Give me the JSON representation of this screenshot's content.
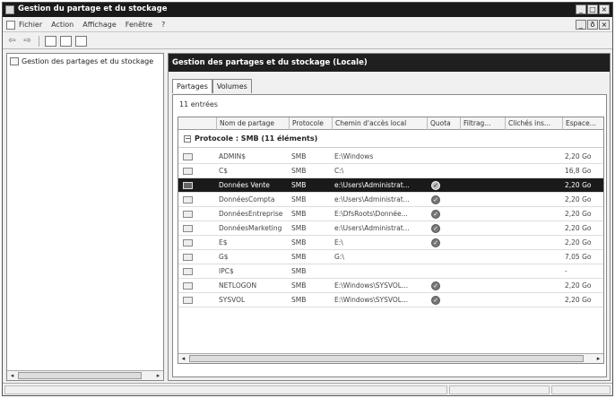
{
  "window": {
    "title": "Gestion du partage et du stockage"
  },
  "menu": [
    "Fichier",
    "Action",
    "Affichage",
    "Fenêtre",
    "?"
  ],
  "window_buttons": [
    "_",
    "□",
    "×"
  ],
  "mdi_buttons": [
    "_",
    "ð",
    "×"
  ],
  "tree": {
    "item": "Gestion des partages et du stockage"
  },
  "panel": {
    "header": "Gestion des partages et du stockage (Locale)",
    "tabs": [
      "Partages",
      "Volumes"
    ],
    "count": "11 entrées"
  },
  "grid": {
    "columns": [
      "Nom de partage",
      "Protocole",
      "Chemin d'accès local",
      "Quota",
      "Filtrag...",
      "Clichés ins...",
      "Espace..."
    ],
    "group": "Protocole : SMB (11 éléments)",
    "group_toggle": "−",
    "rows": [
      {
        "name": "ADMIN$",
        "protocol": "SMB",
        "path": "E:\\Windows",
        "quota": false,
        "space": "2,20 Go"
      },
      {
        "name": "C$",
        "protocol": "SMB",
        "path": "C:\\",
        "quota": false,
        "space": "16,8 Go"
      },
      {
        "name": "Données Vente",
        "protocol": "SMB",
        "path": "e:\\Users\\Administrat...",
        "quota": true,
        "space": "2,20 Go",
        "selected": true
      },
      {
        "name": "DonnéesCompta",
        "protocol": "SMB",
        "path": "e:\\Users\\Administrat...",
        "quota": true,
        "space": "2,20 Go"
      },
      {
        "name": "DonnéesEntreprise",
        "protocol": "SMB",
        "path": "E:\\DfsRoots\\Donnée...",
        "quota": true,
        "space": "2,20 Go"
      },
      {
        "name": "DonnéesMarketing",
        "protocol": "SMB",
        "path": "e:\\Users\\Administrat...",
        "quota": true,
        "space": "2,20 Go"
      },
      {
        "name": "E$",
        "protocol": "SMB",
        "path": "E:\\",
        "quota": true,
        "space": "2,20 Go"
      },
      {
        "name": "G$",
        "protocol": "SMB",
        "path": "G:\\",
        "quota": false,
        "space": "7,05 Go"
      },
      {
        "name": "IPC$",
        "protocol": "SMB",
        "path": "",
        "quota": false,
        "space": "-"
      },
      {
        "name": "NETLOGON",
        "protocol": "SMB",
        "path": "E:\\Windows\\SYSVOL...",
        "quota": true,
        "space": "2,20 Go"
      },
      {
        "name": "SYSVOL",
        "protocol": "SMB",
        "path": "E:\\Windows\\SYSVOL...",
        "quota": true,
        "space": "2,20 Go"
      }
    ]
  },
  "scroll_arrows": {
    "left": "◂",
    "right": "▸"
  }
}
